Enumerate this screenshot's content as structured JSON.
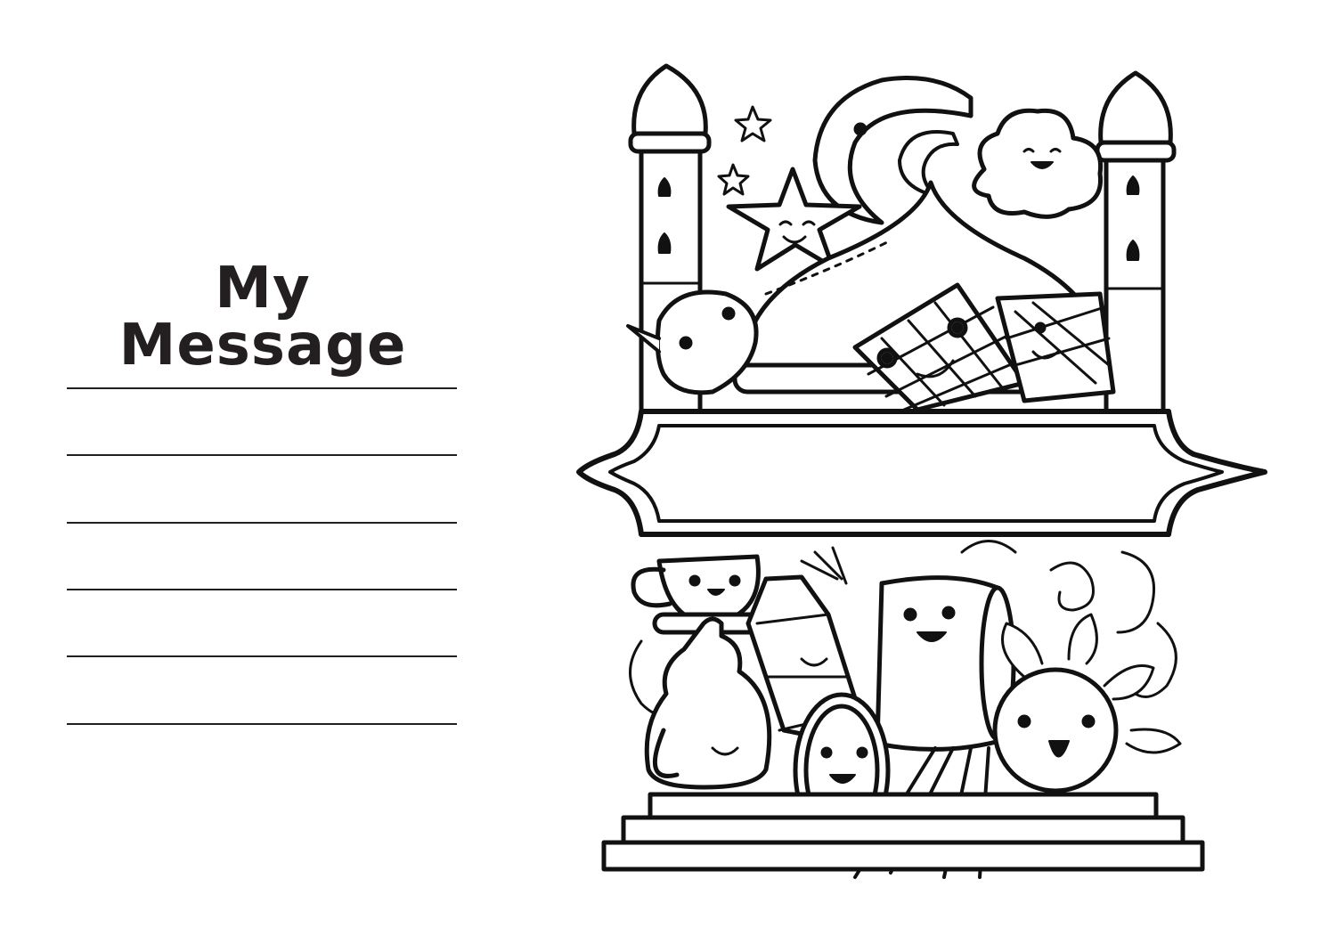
{
  "message": {
    "title": "My Message",
    "line_count": 6
  },
  "illustration": {
    "description_icon": "ramadan-doodle-icon",
    "ink_color": "#111111"
  }
}
